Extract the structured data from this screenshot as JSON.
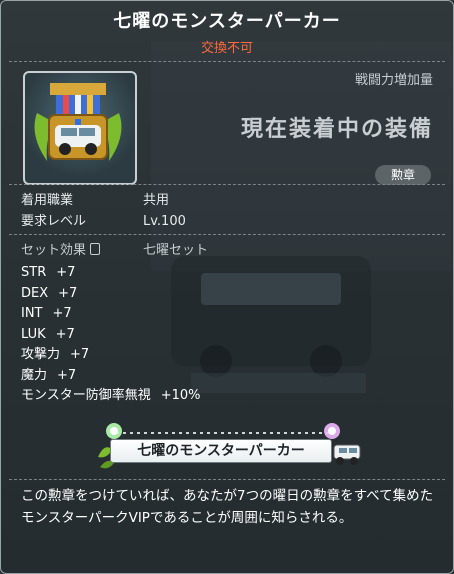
{
  "item": {
    "name": "七曜のモンスターパーカー",
    "trade_status": "交換不可",
    "power_label": "戦闘力増加量",
    "equipped_text": "現在装着中の装備",
    "category": "勲章"
  },
  "requirements": [
    {
      "label": "着用職業",
      "value": "共用"
    },
    {
      "label": "要求レベル",
      "value": "Lv.100"
    }
  ],
  "set": {
    "label": "セット効果",
    "name": "七曜セット"
  },
  "stats": [
    {
      "name": "STR",
      "value": "+7"
    },
    {
      "name": "DEX",
      "value": "+7"
    },
    {
      "name": "INT",
      "value": "+7"
    },
    {
      "name": "LUK",
      "value": "+7"
    },
    {
      "name": "攻撃力",
      "value": "+7"
    },
    {
      "name": "魔力",
      "value": "+7"
    },
    {
      "name": "モンスター防御率無視",
      "value": "+10%"
    }
  ],
  "medal_banner": "七曜のモンスターパーカー",
  "description": "この勲章をつけていれば、あなたが7つの曜日の勲章をすべて集めたモンスターパークVIPであることが周囲に知らされる。",
  "colors": {
    "title": "#ffffff",
    "trade_status": "#ff6a3d",
    "text": "#e6eaec"
  }
}
